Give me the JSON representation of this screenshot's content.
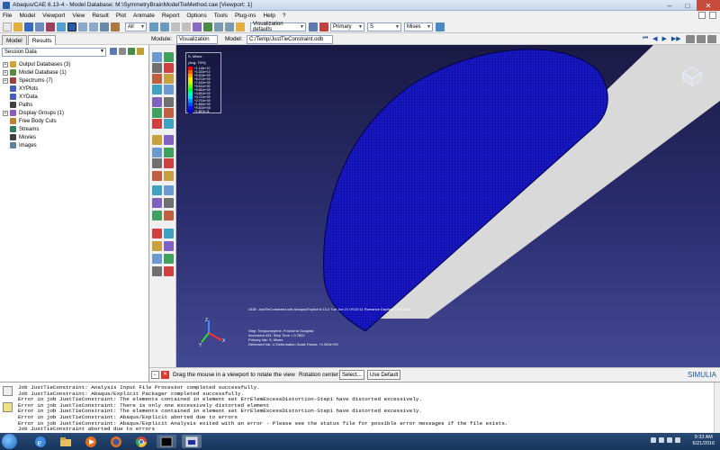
{
  "window": {
    "title": "Abaqus/CAE 6.13-4 - Model Database: M:\\SymmetryBrainModelTieMethod.cae [Viewport: 1]"
  },
  "menu": [
    "File",
    "Model",
    "Viewport",
    "View",
    "Result",
    "Plot",
    "Animate",
    "Report",
    "Options",
    "Tools",
    "Plug-ins",
    "Help",
    "?"
  ],
  "toolbar": {
    "selection_filter": "All",
    "view_defaults": "Visualization defaults",
    "primary": "Primary",
    "variable": "S",
    "invariant": "Mises"
  },
  "left_tabs": [
    "Model",
    "Results"
  ],
  "module_bar": {
    "module_label": "Module:",
    "module_value": "Visualization",
    "model_label": "Model:",
    "model_value": "C:/Temp/JustTieConstraint.odb"
  },
  "session": {
    "label": "Session Data"
  },
  "tree": [
    {
      "label": "Output Databases (3)",
      "expander": "+",
      "color": "#d9a03a"
    },
    {
      "label": "Model Database (1)",
      "expander": "+",
      "color": "#5a8a3a"
    },
    {
      "label": "Spectrums (7)",
      "expander": "+",
      "color": "#a04040"
    },
    {
      "label": "XYPlots",
      "expander": "",
      "color": "#4060c0"
    },
    {
      "label": "XYData",
      "expander": "",
      "color": "#4060c0"
    },
    {
      "label": "Paths",
      "expander": "",
      "color": "#404040"
    },
    {
      "label": "Display Groups (1)",
      "expander": "+",
      "color": "#8a5ac0"
    },
    {
      "label": "Free Body Cuts",
      "expander": "",
      "color": "#c08030"
    },
    {
      "label": "Streams",
      "expander": "",
      "color": "#308060"
    },
    {
      "label": "Movies",
      "expander": "",
      "color": "#404040"
    },
    {
      "label": "Images",
      "expander": "",
      "color": "#6080a0"
    }
  ],
  "legend": {
    "title1": "S, Mises",
    "title2": "(Avg: 75%)",
    "colors": [
      "#ff0000",
      "#ff5a00",
      "#ffaa00",
      "#ffe600",
      "#c8ff00",
      "#64ff00",
      "#00ff3c",
      "#00ffb4",
      "#00dcff",
      "#0096ff",
      "#0050ff",
      "#0014ff",
      "#0000c8"
    ],
    "values": [
      "+1.116e+10",
      "+1.023e+10",
      "+9.303e+09",
      "+8.372e+09",
      "+7.442e+09",
      "+6.511e+09",
      "+5.581e+09",
      "+4.651e+09",
      "+3.721e+09",
      "+2.791e+09",
      "+1.860e+09",
      "+9.302e+08",
      "+1.857e-11"
    ]
  },
  "viewport_info": {
    "odb_line": "ODB: JustTieConstraint.odb    Abaqus/Explicit 6.13-4    Tue Jun 21 09:22:11 Romance Daylight Time 2016",
    "step_lines": [
      "Step: Temporarytime, Frontal to Occipital",
      "Increment    431: Step Time =   0.7820",
      "Primary Var: S, Mises",
      "Deformed Var: U   Deformation Scale Factor: +1.000e+00"
    ]
  },
  "prompt": {
    "text": "Drag the mouse in a viewport to rotate the view",
    "rotation_label": "Rotation center:",
    "select_btn": "Select...",
    "default_btn": "Use Default",
    "brand": "SIMULIA"
  },
  "messages": [
    "Job JustTieConstraint: Analysis Input File Processor completed successfully.",
    "Job JustTieConstraint: Abaqus/Explicit Packager completed successfully.",
    "Error in job JustTieConstraint: The elements contained in element set ErrElemExcessDistortion-Step1 have distorted excessively.",
    "Error in job JustTieConstraint: There is only one excessively distorted element",
    "Error in job JustTieConstraint: The elements contained in element set ErrElemExcessDistortion-Step1 have distorted excessively.",
    "Error in job JustTieConstraint: Abaqus/Explicit aborted due to errors",
    "Error in job JustTieConstraint: Abaqus/Explicit Analysis exited with an error - Please see the  status file for possible error messages if the file exists.",
    "Job JustTieConstraint aborted due to errors"
  ],
  "taskbar": {
    "time": "9:33 AM",
    "date": "6/21/2016"
  }
}
